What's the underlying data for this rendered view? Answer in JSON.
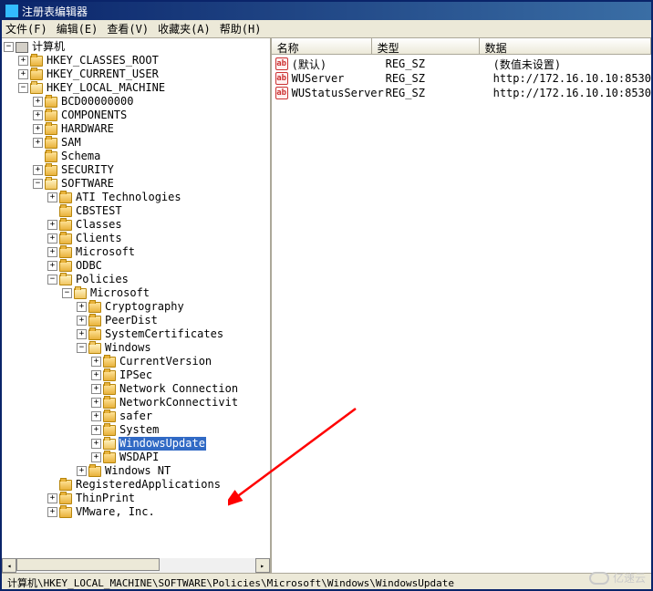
{
  "window": {
    "title": "注册表编辑器"
  },
  "menu": {
    "file": "文件(F)",
    "edit": "编辑(E)",
    "view": "查看(V)",
    "favorites": "收藏夹(A)",
    "help": "帮助(H)"
  },
  "tree": {
    "root": "计算机",
    "hkcr": "HKEY_CLASSES_ROOT",
    "hkcu": "HKEY_CURRENT_USER",
    "hklm": "HKEY_LOCAL_MACHINE",
    "bcd": "BCD00000000",
    "components": "COMPONENTS",
    "hardware": "HARDWARE",
    "sam": "SAM",
    "schema": "Schema",
    "security": "SECURITY",
    "software": "SOFTWARE",
    "ati": "ATI Technologies",
    "cbstest": "CBSTEST",
    "classes": "Classes",
    "clients": "Clients",
    "microsoft": "Microsoft",
    "odbc": "ODBC",
    "policies": "Policies",
    "pmicrosoft": "Microsoft",
    "crypto": "Cryptography",
    "peerdist": "PeerDist",
    "syscert": "SystemCertificates",
    "windows": "Windows",
    "curver": "CurrentVersion",
    "ipsec": "IPSec",
    "netconn": "Network Connection",
    "netconnv": "NetworkConnectivit",
    "safer": "safer",
    "system": "System",
    "wupdate": "WindowsUpdate",
    "wsdapi": "WSDAPI",
    "winnt": "Windows NT",
    "regapp": "RegisteredApplications",
    "thinprint": "ThinPrint",
    "vmware": "VMware, Inc."
  },
  "list": {
    "cols": {
      "name": "名称",
      "type": "类型",
      "data": "数据"
    },
    "rows": [
      {
        "name": "(默认)",
        "type": "REG_SZ",
        "data": "(数值未设置)"
      },
      {
        "name": "WUServer",
        "type": "REG_SZ",
        "data": "http://172.16.10.10:8530"
      },
      {
        "name": "WUStatusServer",
        "type": "REG_SZ",
        "data": "http://172.16.10.10:8530"
      }
    ]
  },
  "status": "计算机\\HKEY_LOCAL_MACHINE\\SOFTWARE\\Policies\\Microsoft\\Windows\\WindowsUpdate",
  "watermark": "亿速云",
  "exp_plus": "+",
  "exp_minus": "−"
}
